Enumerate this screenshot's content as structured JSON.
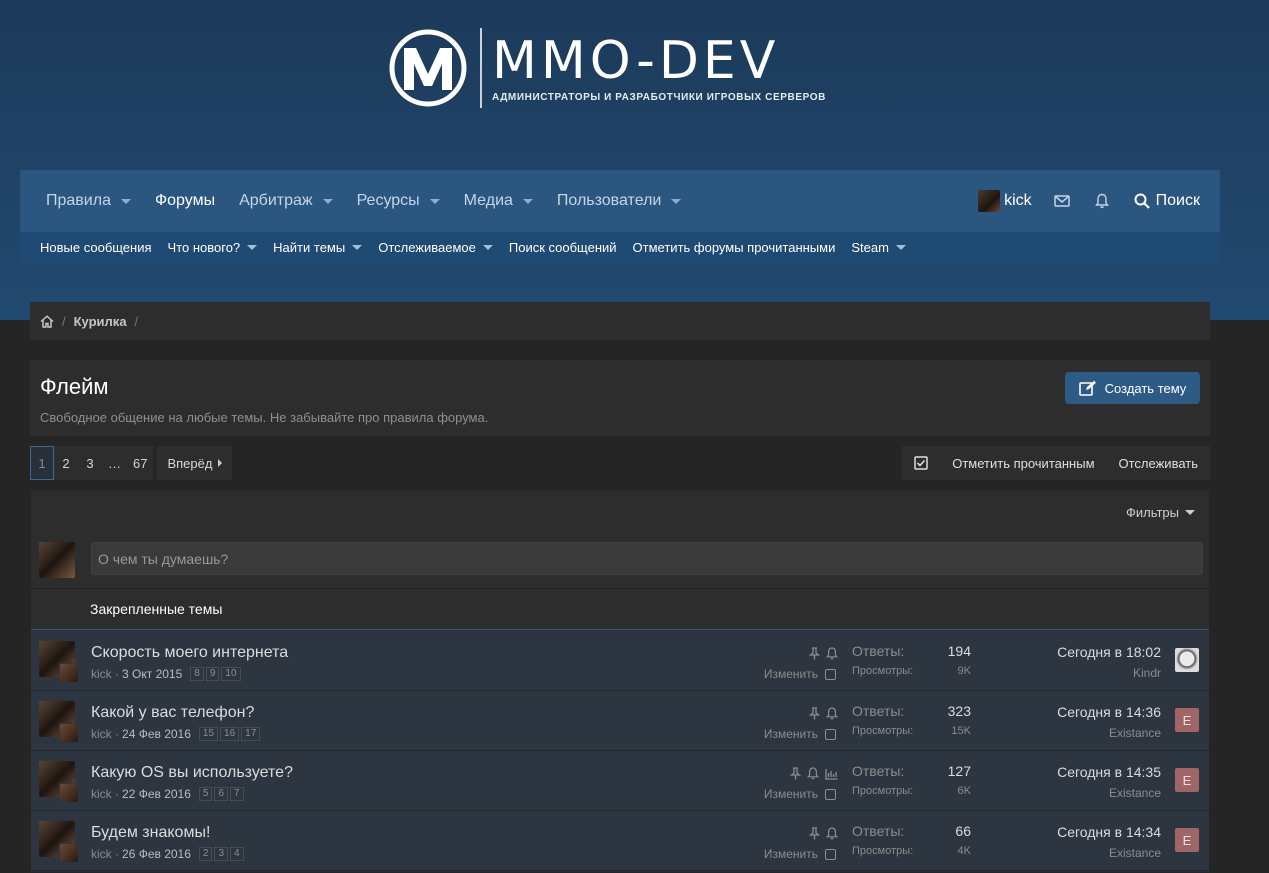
{
  "logo": {
    "title": "MMO-DEV",
    "subtitle": "АДМИНИСТРАТОРЫ И РАЗРАБОТЧИКИ ИГРОВЫХ СЕРВЕРОВ"
  },
  "nav": {
    "tabs": [
      {
        "label": "Правила",
        "dropdown": true
      },
      {
        "label": "Форумы",
        "dropdown": false,
        "active": true
      },
      {
        "label": "Арбитраж",
        "dropdown": true
      },
      {
        "label": "Ресурсы",
        "dropdown": true
      },
      {
        "label": "Медиа",
        "dropdown": true
      },
      {
        "label": "Пользователи",
        "dropdown": true
      }
    ],
    "username": "kick",
    "search_label": "Поиск",
    "sub": [
      "Новые сообщения",
      "Что нового?",
      "Найти темы",
      "Отслеживаемое",
      "Поиск сообщений",
      "Отметить форумы прочитанными",
      "Steam"
    ]
  },
  "breadcrumb": {
    "item": "Курилка"
  },
  "header": {
    "title": "Флейм",
    "description": "Свободное общение на любые темы. Не забывайте про правила форума.",
    "create_label": "Создать тему"
  },
  "pager": {
    "pages": [
      "1",
      "2",
      "3",
      "…",
      "67"
    ],
    "next_label": "Вперёд"
  },
  "actions": {
    "mark_read": "Отметить прочитанным",
    "watch": "Отслеживать"
  },
  "list": {
    "filters_label": "Фильтры",
    "quick_placeholder": "О чем ты думаешь?",
    "pinned_label": "Закрепленные темы",
    "replies_label": "Ответы:",
    "views_label": "Просмотры:",
    "edit_label": "Изменить",
    "threads": [
      {
        "title": "Скорость моего интернета",
        "author": "kick",
        "date": "3 Окт 2015",
        "pages": [
          "8",
          "9",
          "10"
        ],
        "replies": "194",
        "views": "9K",
        "last_time": "Сегодня в 18:02",
        "last_user": "Kindr",
        "last_avatar": "",
        "poll": false
      },
      {
        "title": "Какой у вас телефон?",
        "author": "kick",
        "date": "24 Фев 2016",
        "pages": [
          "15",
          "16",
          "17"
        ],
        "replies": "323",
        "views": "15K",
        "last_time": "Сегодня в 14:36",
        "last_user": "Existance",
        "last_avatar": "E",
        "poll": false
      },
      {
        "title": "Какую OS вы используете?",
        "author": "kick",
        "date": "22 Фев 2016",
        "pages": [
          "5",
          "6",
          "7"
        ],
        "replies": "127",
        "views": "6K",
        "last_time": "Сегодня в 14:35",
        "last_user": "Existance",
        "last_avatar": "E",
        "poll": true
      },
      {
        "title": "Будем знакомы!",
        "author": "kick",
        "date": "26 Фев 2016",
        "pages": [
          "2",
          "3",
          "4"
        ],
        "replies": "66",
        "views": "4K",
        "last_time": "Сегодня в 14:34",
        "last_user": "Existance",
        "last_avatar": "E",
        "poll": false
      }
    ]
  }
}
